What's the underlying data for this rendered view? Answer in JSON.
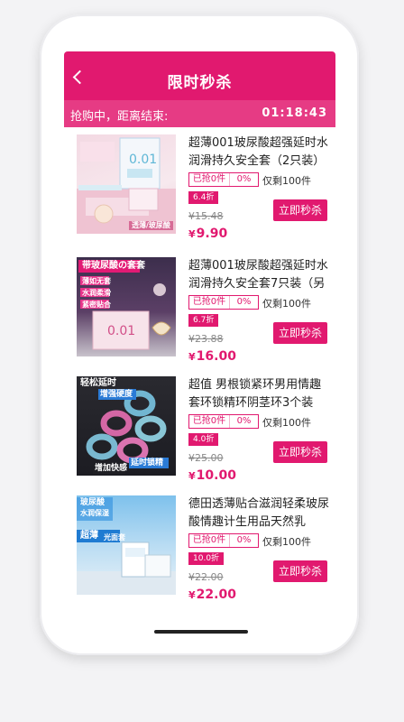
{
  "header": {
    "title": "限时秒杀",
    "back_icon": "chevron-left-icon"
  },
  "timer": {
    "label": "抢购中，距离结束:",
    "time": "01:18:43"
  },
  "colors": {
    "accent": "#e1196f",
    "timer_bg": "#e63b84"
  },
  "products": [
    {
      "name": "超薄001玻尿酸超强延时水润滑持久安全套（2只装）",
      "sold": "已抢0件",
      "percent": "0%",
      "remaining": "仅剩100件",
      "discount": "6.4折",
      "old_price": "¥15.48",
      "currency": "¥",
      "price": "9.90",
      "buy_label": "立即秒杀",
      "image_caption": "透薄/玻尿酸"
    },
    {
      "name": "超薄001玻尿酸超强延时水润滑持久安全套7只装（另",
      "sold": "已抢0件",
      "percent": "0%",
      "remaining": "仅剩100件",
      "discount": "6.7折",
      "old_price": "¥23.88",
      "currency": "¥",
      "price": "16.00",
      "buy_label": "立即秒杀",
      "image_tags": [
        "带玻尿酸の套套",
        "薄如无套",
        "水润柔滑",
        "紧密贴合"
      ]
    },
    {
      "name": "超值 男根锁紧环男用情趣套环锁精环阴茎环3个装",
      "sold": "已抢0件",
      "percent": "0%",
      "remaining": "仅剩100件",
      "discount": "4.0折",
      "old_price": "¥25.00",
      "currency": "¥",
      "price": "10.00",
      "buy_label": "立即秒杀",
      "image_tags": [
        "轻松延时",
        "增强硬度",
        "延时锁精",
        "增加快感"
      ]
    },
    {
      "name": "德田透薄贴合滋润轻柔玻尿酸情趣计生用品天然乳",
      "sold": "已抢0件",
      "percent": "0%",
      "remaining": "仅剩100件",
      "discount": "10.0折",
      "old_price": "¥22.00",
      "currency": "¥",
      "price": "22.00",
      "buy_label": "立即秒杀",
      "image_tags": [
        "玻尿酸",
        "水润保湿",
        "超薄",
        "光面套"
      ]
    }
  ]
}
